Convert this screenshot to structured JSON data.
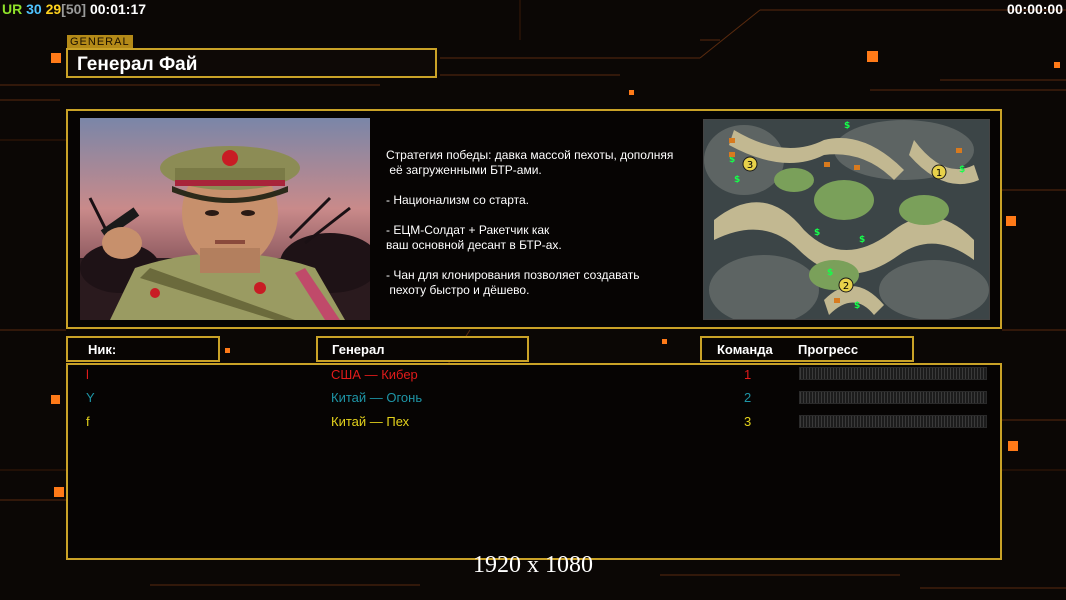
{
  "hud": {
    "ur_label": "UR",
    "fps_value": "30",
    "logic_value": "29",
    "logic_cap": "[50]",
    "elapsed_time": "00:01:17",
    "right_time": "00:00:00"
  },
  "general": {
    "category_label": "GENERAL",
    "name": "Генерал Фай",
    "description": "Стратегия победы: давка массой пехоты, дополняя\n её загруженными БТР-ами.\n\n- Национализм со старта.\n\n- ЕЦМ-Солдат + Ракетчик как\nваш основной десант в БТР-ах.\n\n- Чан для клонирования позволяет создавать\n пехоту быстро и дёшево."
  },
  "map": {
    "markers": [
      "1",
      "2",
      "3"
    ]
  },
  "table": {
    "headers": {
      "nick": "Ник:",
      "general": "Генерал",
      "team": "Команда",
      "progress": "Прогресс"
    },
    "rows": [
      {
        "nick": "l",
        "general": "США — Кибер",
        "team": "1",
        "color": "#e11b1b"
      },
      {
        "nick": "Y",
        "general": "Китай — Огонь",
        "team": "2",
        "color": "#1e95a6"
      },
      {
        "nick": "f",
        "general": "Китай — Пех",
        "team": "3",
        "color": "#e3d21c"
      }
    ]
  },
  "resolution_label": "1920 x 1080",
  "colors": {
    "frame": "#c9a227",
    "accent_orange": "#ff7a18",
    "hud_green": "#8fe02a",
    "hud_cyan": "#4fc3ff",
    "hud_yellow": "#ffd21e"
  }
}
